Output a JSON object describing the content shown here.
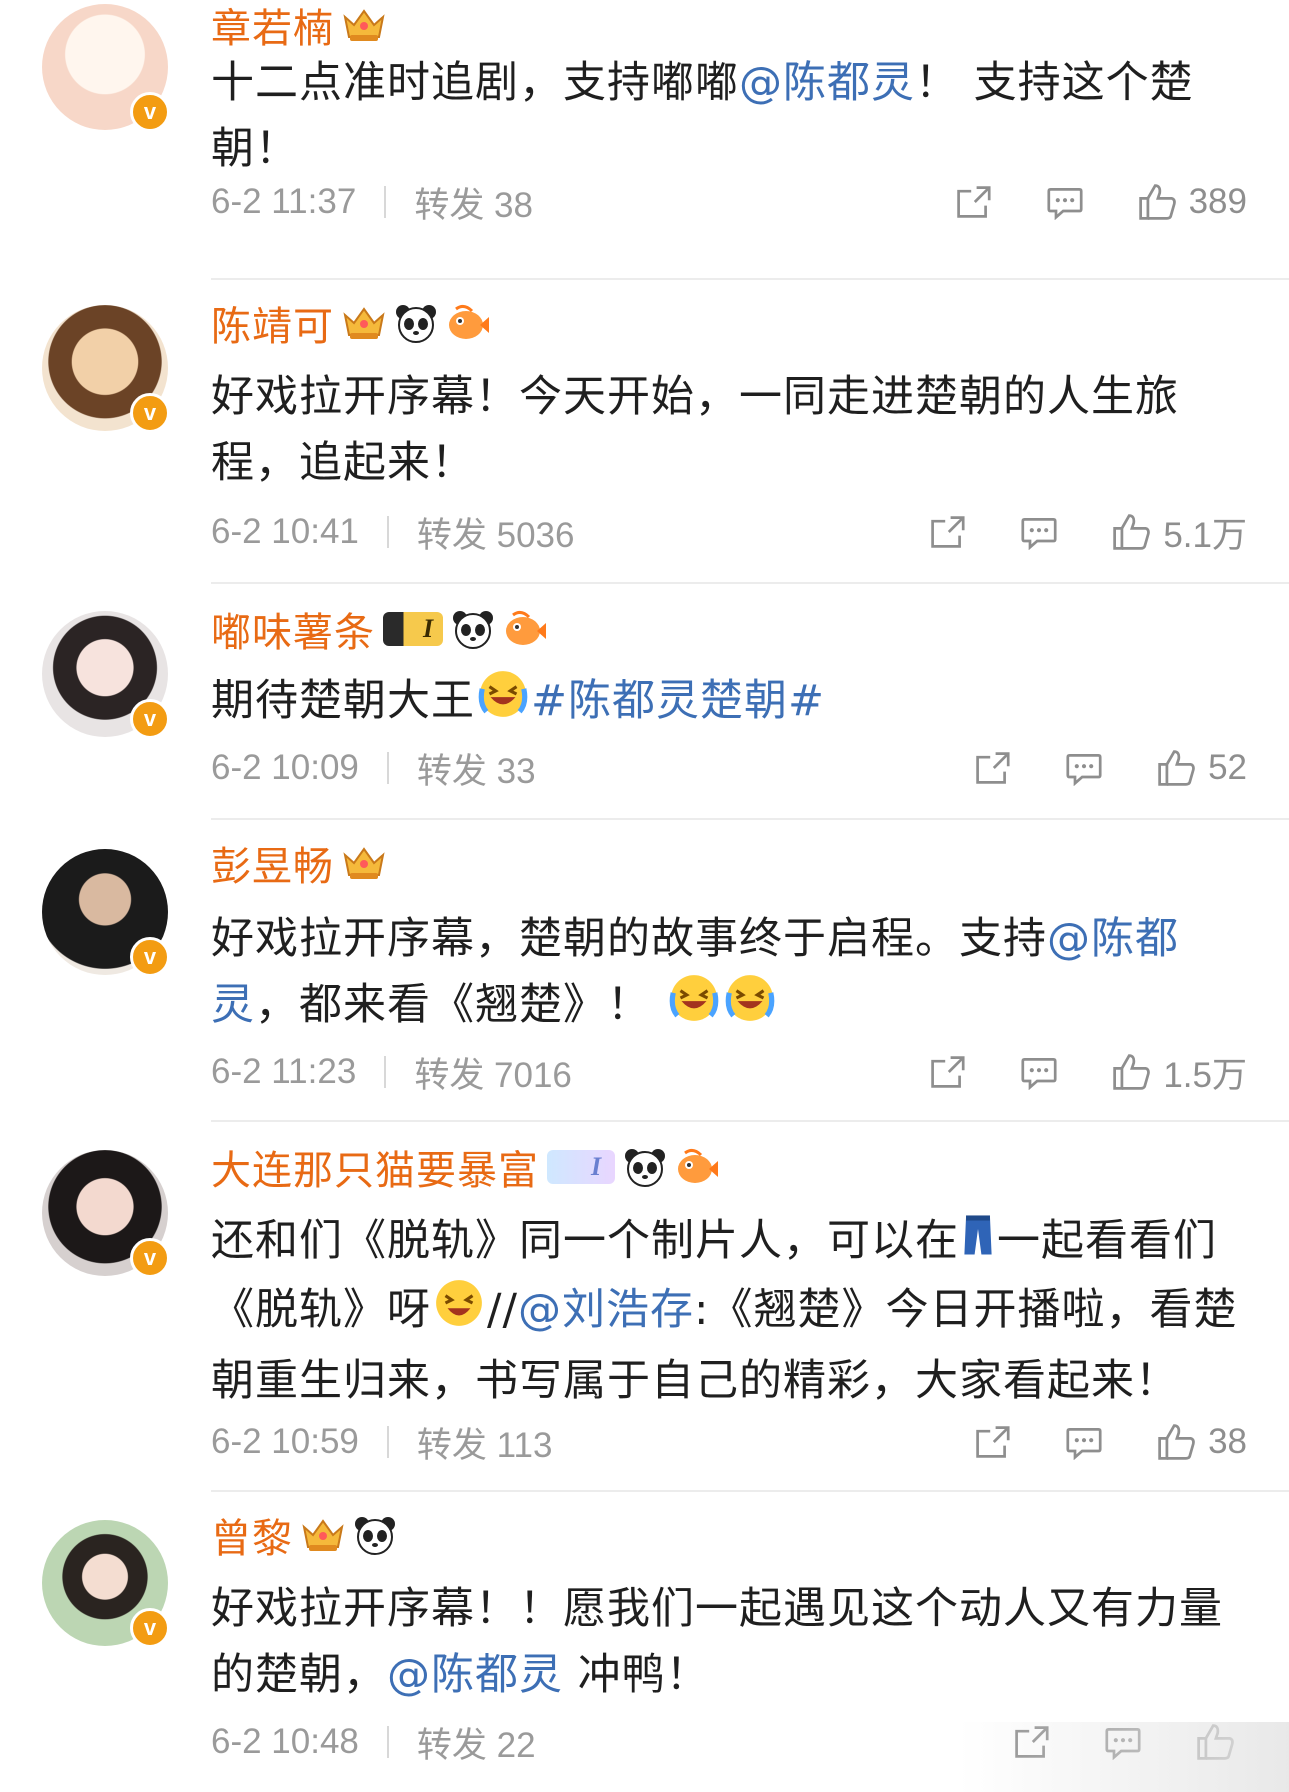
{
  "comments": [
    {
      "name": "章若楠",
      "segments": [
        {
          "t": "十二点准时追剧，支持嘟嘟"
        },
        {
          "t": "@陈都灵",
          "m": true
        },
        {
          "t": "！ 支持这个楚朝！"
        }
      ],
      "time": "6-2 11:37",
      "repost": "转发 38",
      "likes": "389",
      "badges": [
        "crown"
      ]
    },
    {
      "name": "陈靖可",
      "segments": [
        {
          "t": "好戏拉开序幕！今天开始，一同走进楚朝的人生旅程，追起来！"
        }
      ],
      "time": "6-2 10:41",
      "repost": "转发 5036",
      "likes": "5.1万",
      "badges": [
        "crown",
        "panda",
        "fish"
      ]
    },
    {
      "name": "嘟味薯条",
      "segments": [
        {
          "t": "期待楚朝大王"
        },
        {
          "emoji": "laugh-cry-emoji"
        },
        {
          "t": "#陈都灵楚朝#",
          "m": true
        }
      ],
      "time": "6-2 10:09",
      "repost": "转发 33",
      "likes": "52",
      "badges": [
        "level",
        "panda",
        "fish"
      ],
      "level": "I"
    },
    {
      "name": "彭昱畅",
      "segments": [
        {
          "t": "好戏拉开序幕，楚朝的故事终于启程。支持"
        },
        {
          "t": "@陈都灵",
          "m": true
        },
        {
          "t": "，都来看《翘楚》！ "
        },
        {
          "emoji": "laugh-cry-emoji"
        },
        {
          "emoji": "laugh-cry-emoji"
        }
      ],
      "time": "6-2 11:23",
      "repost": "转发 7016",
      "likes": "1.5万",
      "badges": [
        "crown"
      ]
    },
    {
      "name": "大连那只猫要暴富",
      "segments": [
        {
          "t": "还和们《脱轨》同一个制片人，可以在"
        },
        {
          "emoji": "jeans-emoji"
        },
        {
          "t": "一起看看们《脱轨》呀"
        },
        {
          "emoji": "grin-emoji"
        },
        {
          "t": "//"
        },
        {
          "t": "@刘浩存",
          "m": true
        },
        {
          "t": ":《翘楚》今日开播啦，看楚朝重生归来，书写属于自己的精彩，大家看起来！"
        }
      ],
      "time": "6-2 10:59",
      "repost": "转发 113",
      "likes": "38",
      "badges": [
        "level-soft",
        "panda",
        "fish"
      ],
      "level": "I"
    },
    {
      "name": "曾黎",
      "segments": [
        {
          "t": "好戏拉开序幕！！愿我们一起遇见这个动人又有力量的楚朝，"
        },
        {
          "t": "@陈都灵",
          "m": true
        },
        {
          "t": " 冲鸭！"
        }
      ],
      "time": "6-2 10:48",
      "repost": "转发 22",
      "likes": "",
      "badges": [
        "crown",
        "panda"
      ]
    }
  ],
  "colors": {
    "name": "#e86a14",
    "mention": "#3d6fb5",
    "meta": "#9a9a9a",
    "verified": "#f39c12"
  },
  "icons": {
    "share": "share-icon",
    "comment": "comment-icon",
    "like": "like-icon"
  }
}
